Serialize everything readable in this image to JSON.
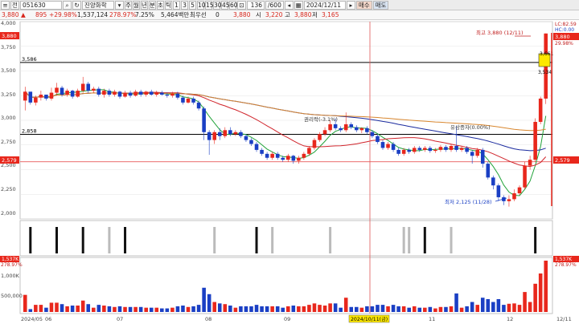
{
  "toolbar": {
    "menu_icon": "≡",
    "market": "전",
    "code": "051630",
    "search_icon": "search-icon",
    "stock_name": "진양화학",
    "period_labels": [
      "주",
      "월",
      "년",
      "분",
      "초",
      "틱"
    ],
    "interval_labels": [
      "1",
      "3",
      "5",
      "10",
      "15",
      "30",
      "45",
      "60"
    ],
    "count": "136",
    "count_total": "/600",
    "date": "2024/12/11",
    "sell_label": "매수",
    "buy_label": "매도"
  },
  "quote": {
    "price": "3,880",
    "change": "895",
    "change_pct": "+29.98%",
    "volume": "1,537,124",
    "volume_ratio": "278.97%",
    "turnover": "7.25%",
    "amount": "5,464백만",
    "pref_label": "최우선",
    "pref_value": "0",
    "current": "3,880",
    "open_label": "시",
    "open": "3,220",
    "high_label": "고",
    "high": "3,880",
    "low_label": "저",
    "low": "3,165"
  },
  "colors": {
    "up": "#e8271c",
    "down": "#1a3fc4",
    "ma5": "#22a33a",
    "ma20": "#d0232a",
    "ma60": "#1a2a9e",
    "ma120": "#d8862e",
    "hline": "#000000",
    "red_line": "#e23a3a"
  },
  "chart_data": {
    "type": "candlestick",
    "price_axis_ticks": [
      "4,000",
      "3,750",
      "3,500",
      "3,250",
      "3,000",
      "2,750",
      "2,500",
      "2,250",
      "2,000"
    ],
    "ylim": [
      2000,
      4000
    ],
    "x_labels": [
      "2024/05",
      "06",
      "07",
      "08",
      "09",
      "11",
      "12",
      "12/11"
    ],
    "date_box": "2024/10/11(금)",
    "horizontal_lines": [
      {
        "value": 3586,
        "label": "3,586"
      },
      {
        "value": 2858,
        "label": "2,858"
      }
    ],
    "red_level": {
      "value": 2579,
      "label": "2,579"
    },
    "annotations": [
      {
        "text": "최고 3,880 (12/11)",
        "value": 3880
      },
      {
        "text": "최저 2,125 (11/28)",
        "value": 2125
      },
      {
        "text": "유상증자(0.00%)",
        "value": 2930
      },
      {
        "text": "권리락(-3.1%)",
        "value": 3000
      }
    ],
    "right_badges": [
      {
        "text": "3,880",
        "value": 3880
      },
      {
        "text": "LC:82.59",
        "value": 4000
      },
      {
        "text": "HC:0.00",
        "value": 3950
      },
      {
        "text": "29.98%",
        "value": 3810
      },
      {
        "text": "2,579",
        "value": 2579
      }
    ],
    "marker_box": {
      "top": "3,661",
      "bottom": "3,534"
    },
    "candles": [
      [
        3200,
        3290,
        3150,
        3100,
        3340
      ],
      [
        3290,
        3180,
        3320,
        3160,
        3200
      ],
      [
        3180,
        3230,
        3190,
        3150,
        3250
      ],
      [
        3230,
        3260,
        3210,
        3200,
        3300
      ],
      [
        3260,
        3220,
        3290,
        3200,
        3260
      ],
      [
        3220,
        3280,
        3230,
        3200,
        3330
      ],
      [
        3280,
        3330,
        3290,
        3250,
        3380
      ],
      [
        3330,
        3260,
        3340,
        3240,
        3350
      ],
      [
        3260,
        3300,
        3270,
        3240,
        3320
      ],
      [
        3300,
        3240,
        3310,
        3220,
        3310
      ],
      [
        3240,
        3300,
        3250,
        3230,
        3320
      ],
      [
        3300,
        3370,
        3310,
        3280,
        3440
      ],
      [
        3370,
        3300,
        3380,
        3280,
        3390
      ],
      [
        3300,
        3320,
        3310,
        3280,
        3340
      ],
      [
        3320,
        3260,
        3330,
        3240,
        3340
      ],
      [
        3260,
        3300,
        3270,
        3230,
        3320
      ],
      [
        3300,
        3260,
        3310,
        3240,
        3320
      ],
      [
        3260,
        3290,
        3270,
        3240,
        3310
      ],
      [
        3290,
        3240,
        3300,
        3220,
        3300
      ],
      [
        3240,
        3280,
        3250,
        3230,
        3300
      ],
      [
        3280,
        3250,
        3290,
        3230,
        3300
      ],
      [
        3250,
        3290,
        3260,
        3240,
        3310
      ],
      [
        3290,
        3260,
        3300,
        3240,
        3310
      ],
      [
        3260,
        3290,
        3270,
        3240,
        3300
      ],
      [
        3290,
        3260,
        3300,
        3250,
        3310
      ],
      [
        3260,
        3280,
        3270,
        3240,
        3300
      ],
      [
        3280,
        3260,
        3290,
        3250,
        3300
      ],
      [
        3260,
        3250,
        3270,
        3230,
        3280
      ],
      [
        3250,
        3270,
        3260,
        3230,
        3290
      ],
      [
        3270,
        3230,
        3280,
        3210,
        3290
      ],
      [
        3230,
        3180,
        3240,
        3160,
        3250
      ],
      [
        3180,
        3220,
        3190,
        3170,
        3240
      ],
      [
        3220,
        3180,
        3230,
        3160,
        3240
      ],
      [
        3180,
        3120,
        3190,
        3100,
        3200
      ],
      [
        3120,
        2880,
        3130,
        2800,
        3140
      ],
      [
        2880,
        2800,
        2890,
        2650,
        2900
      ],
      [
        2800,
        2880,
        2810,
        2760,
        2900
      ],
      [
        2880,
        2840,
        2890,
        2800,
        2920
      ],
      [
        2840,
        2900,
        2850,
        2820,
        2930
      ],
      [
        2900,
        2860,
        2910,
        2840,
        2930
      ],
      [
        2860,
        2880,
        2870,
        2840,
        2900
      ],
      [
        2880,
        2840,
        2890,
        2820,
        2900
      ],
      [
        2840,
        2800,
        2850,
        2780,
        2860
      ],
      [
        2800,
        2760,
        2810,
        2740,
        2820
      ],
      [
        2760,
        2700,
        2770,
        2680,
        2780
      ],
      [
        2700,
        2660,
        2710,
        2640,
        2720
      ],
      [
        2660,
        2620,
        2670,
        2600,
        2680
      ],
      [
        2620,
        2660,
        2630,
        2600,
        2680
      ],
      [
        2660,
        2620,
        2670,
        2600,
        2680
      ],
      [
        2620,
        2600,
        2630,
        2580,
        2640
      ],
      [
        2600,
        2640,
        2610,
        2580,
        2660
      ],
      [
        2640,
        2590,
        2650,
        2560,
        2650
      ],
      [
        2590,
        2620,
        2600,
        2560,
        2640
      ],
      [
        2620,
        2660,
        2630,
        2600,
        2680
      ],
      [
        2660,
        2720,
        2670,
        2640,
        2740
      ],
      [
        2720,
        2800,
        2730,
        2700,
        2820
      ],
      [
        2800,
        2860,
        2810,
        2780,
        2880
      ],
      [
        2860,
        2900,
        2870,
        2840,
        2930
      ],
      [
        2900,
        2960,
        2910,
        2880,
        3000
      ],
      [
        2960,
        2920,
        2970,
        2900,
        3020
      ],
      [
        2920,
        2900,
        2930,
        2880,
        2940
      ],
      [
        2900,
        2960,
        2910,
        2880,
        3080
      ],
      [
        2960,
        2930,
        2970,
        2910,
        2980
      ],
      [
        2930,
        2900,
        2940,
        2880,
        2950
      ],
      [
        2900,
        2920,
        2910,
        2870,
        2930
      ],
      [
        2920,
        2880,
        2930,
        2860,
        2940
      ],
      [
        2880,
        2840,
        2890,
        2820,
        2900
      ],
      [
        2840,
        2780,
        2850,
        2760,
        2860
      ],
      [
        2780,
        2720,
        2790,
        2700,
        2800
      ],
      [
        2720,
        2760,
        2730,
        2700,
        2780
      ],
      [
        2760,
        2700,
        2770,
        2680,
        2780
      ],
      [
        2700,
        2660,
        2710,
        2640,
        2720
      ],
      [
        2660,
        2700,
        2670,
        2640,
        2720
      ],
      [
        2700,
        2680,
        2710,
        2660,
        2720
      ],
      [
        2680,
        2720,
        2690,
        2660,
        2740
      ],
      [
        2720,
        2700,
        2730,
        2680,
        2740
      ],
      [
        2700,
        2720,
        2710,
        2680,
        2740
      ],
      [
        2720,
        2690,
        2730,
        2670,
        2740
      ],
      [
        2690,
        2700,
        2700,
        2670,
        2720
      ],
      [
        2700,
        2730,
        2710,
        2680,
        2750
      ],
      [
        2730,
        2700,
        2740,
        2680,
        2750
      ],
      [
        2700,
        2740,
        2710,
        2680,
        2760
      ],
      [
        2740,
        2700,
        2750,
        2680,
        2940
      ],
      [
        2700,
        2720,
        2710,
        2680,
        2740
      ],
      [
        2720,
        2680,
        2730,
        2660,
        2740
      ],
      [
        2680,
        2640,
        2690,
        2560,
        2700
      ],
      [
        2640,
        2700,
        2650,
        2620,
        2720
      ],
      [
        2700,
        2560,
        2710,
        2520,
        2720
      ],
      [
        2560,
        2420,
        2570,
        2400,
        2580
      ],
      [
        2420,
        2340,
        2430,
        2300,
        2440
      ],
      [
        2340,
        2220,
        2350,
        2180,
        2360
      ],
      [
        2220,
        2180,
        2230,
        2140,
        2240
      ],
      [
        2180,
        2200,
        2190,
        2125,
        2240
      ],
      [
        2200,
        2260,
        2210,
        2180,
        2300
      ],
      [
        2260,
        2320,
        2270,
        2240,
        2340
      ],
      [
        2320,
        2540,
        2330,
        2300,
        2580
      ],
      [
        2540,
        2600,
        2550,
        2500,
        2640
      ],
      [
        2600,
        2984,
        2610,
        2580,
        3020
      ],
      [
        2984,
        3220,
        2990,
        2960,
        3240
      ],
      [
        3220,
        3880,
        3220,
        3165,
        3880
      ]
    ],
    "volume_axis_ticks": [
      "1,000K",
      "500,000"
    ],
    "volume_badge": "1,537K",
    "volume_ratio_badge": "278.97%",
    "signal_bars": [
      {
        "i": 2,
        "color": "#111"
      },
      {
        "i": 10,
        "color": "#111"
      },
      {
        "i": 17,
        "color": "#111"
      },
      {
        "i": 25,
        "color": "#bbb"
      },
      {
        "i": 31,
        "color": "#111"
      },
      {
        "i": 58,
        "color": "#bbb"
      },
      {
        "i": 70,
        "color": "#111"
      },
      {
        "i": 75,
        "color": "#bbb"
      },
      {
        "i": 93,
        "color": "#bbb"
      },
      {
        "i": 115,
        "color": "#bbb"
      },
      {
        "i": 117,
        "color": "#bbb"
      },
      {
        "i": 122,
        "color": "#111"
      },
      {
        "i": 130,
        "color": "#bbb"
      },
      {
        "i": 155,
        "color": "#111"
      }
    ]
  }
}
